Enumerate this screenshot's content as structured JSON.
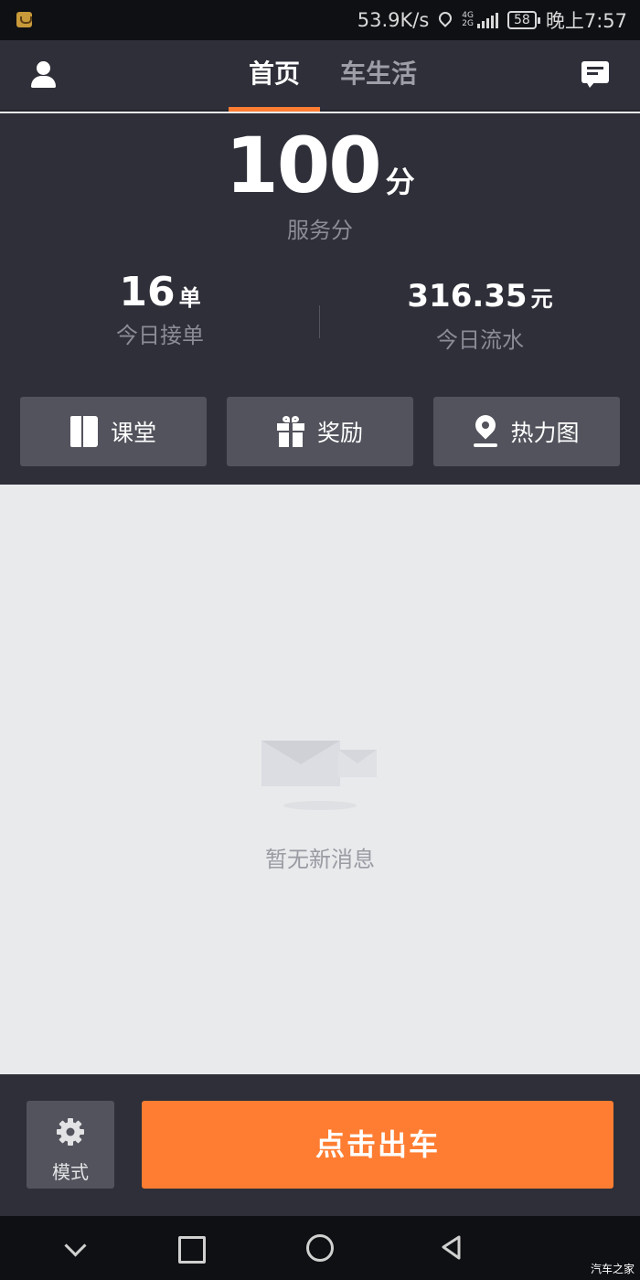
{
  "status_bar": {
    "network_speed": "53.9K/s",
    "network_type_top": "4G",
    "network_type_bottom": "2G",
    "battery": "58",
    "time": "晚上7:57"
  },
  "header": {
    "tabs": [
      {
        "label": "首页",
        "active": true
      },
      {
        "label": "车生活",
        "active": false
      }
    ]
  },
  "stats": {
    "score_value": "100",
    "score_unit": "分",
    "score_label": "服务分",
    "orders_value": "16",
    "orders_unit": "单",
    "orders_label": "今日接单",
    "income_value": "316.35",
    "income_unit": "元",
    "income_label": "今日流水"
  },
  "quick_actions": [
    {
      "label": "课堂",
      "icon": "book-icon"
    },
    {
      "label": "奖励",
      "icon": "gift-icon"
    },
    {
      "label": "热力图",
      "icon": "map-pin-icon"
    }
  ],
  "messages": {
    "empty_text": "暂无新消息"
  },
  "action_bar": {
    "mode_label": "模式",
    "go_label": "点击出车"
  },
  "watermark": "汽车之家",
  "colors": {
    "accent": "#ff7d32",
    "panel": "#2e2f39",
    "button": "#52535c"
  }
}
